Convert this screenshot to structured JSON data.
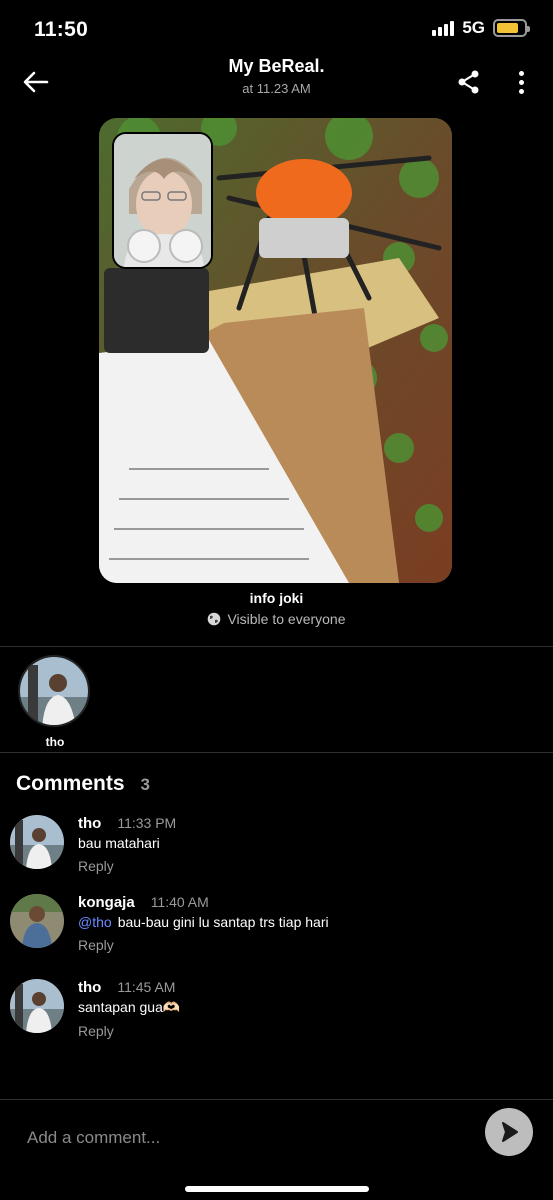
{
  "status_bar": {
    "time": "11:50",
    "network": "5G",
    "battery_level": 0.8,
    "battery_color": "#f2c335"
  },
  "header": {
    "title": "My BeReal.",
    "subtitle": "at 11.23 AM",
    "back_icon": "arrow-left-icon",
    "share_icon": "share-icon",
    "more_icon": "more-vertical-icon"
  },
  "post": {
    "caption": "info joki",
    "visibility": "Visible to everyone",
    "visibility_icon": "globe-icon"
  },
  "reactions": [
    {
      "name": "tho"
    }
  ],
  "comments_section": {
    "title": "Comments",
    "count": "3",
    "items": [
      {
        "user": "tho",
        "time": "11:33 PM",
        "mention": "",
        "text": "bau matahari",
        "reply_label": "Reply"
      },
      {
        "user": "kongaja",
        "time": "11:40 AM",
        "mention": "@tho",
        "text": "bau-bau gini lu santap trs tiap hari",
        "reply_label": "Reply"
      },
      {
        "user": "tho",
        "time": "11:45 AM",
        "mention": "",
        "text": "santapan gua🫶🏻",
        "reply_label": "Reply"
      }
    ]
  },
  "composer": {
    "placeholder": "Add a comment...",
    "send_icon": "send-icon"
  },
  "colors": {
    "background": "#000000",
    "mention": "#6b8cff",
    "muted_text": "#9a9a9a",
    "send_button": "#bdbdbd"
  }
}
